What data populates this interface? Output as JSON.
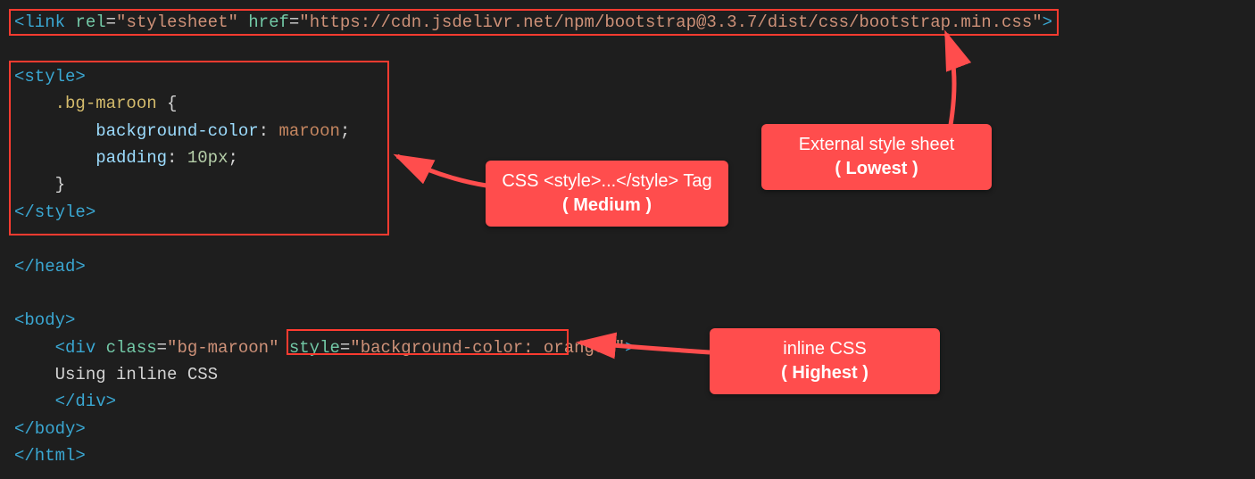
{
  "code": {
    "link_open": "<link",
    "rel_attr": "rel",
    "rel_val": "\"stylesheet\"",
    "href_attr": "href",
    "href_val": "\"https://cdn.jsdelivr.net/npm/bootstrap@3.3.7/dist/css/bootstrap.min.css\"",
    "link_close": ">",
    "style_open": "<style>",
    "selector": ".bg-maroon",
    "brace_open": " {",
    "prop_bg": "background-color",
    "val_bg": "maroon",
    "prop_pad": "padding",
    "val_pad": "10px",
    "brace_close": "}",
    "style_close": "</style>",
    "head_close": "</head>",
    "body_open": "<body>",
    "div_open": "<div",
    "class_attr": "class",
    "class_val": "\"bg-maroon\"",
    "style_attr": "style",
    "style_val": "\"background-color: orange;\"",
    "div_open_close": ">",
    "div_text": "Using inline CSS",
    "div_close": "</div>",
    "body_close": "</body>",
    "html_close": "</html>"
  },
  "callouts": {
    "c1_line1": "External style sheet",
    "c1_line2": "( Lowest )",
    "c2_line1": "CSS <style>...</style> Tag",
    "c2_line2": "( Medium )",
    "c3_line1": "inline CSS",
    "c3_line2": "( Highest )"
  }
}
